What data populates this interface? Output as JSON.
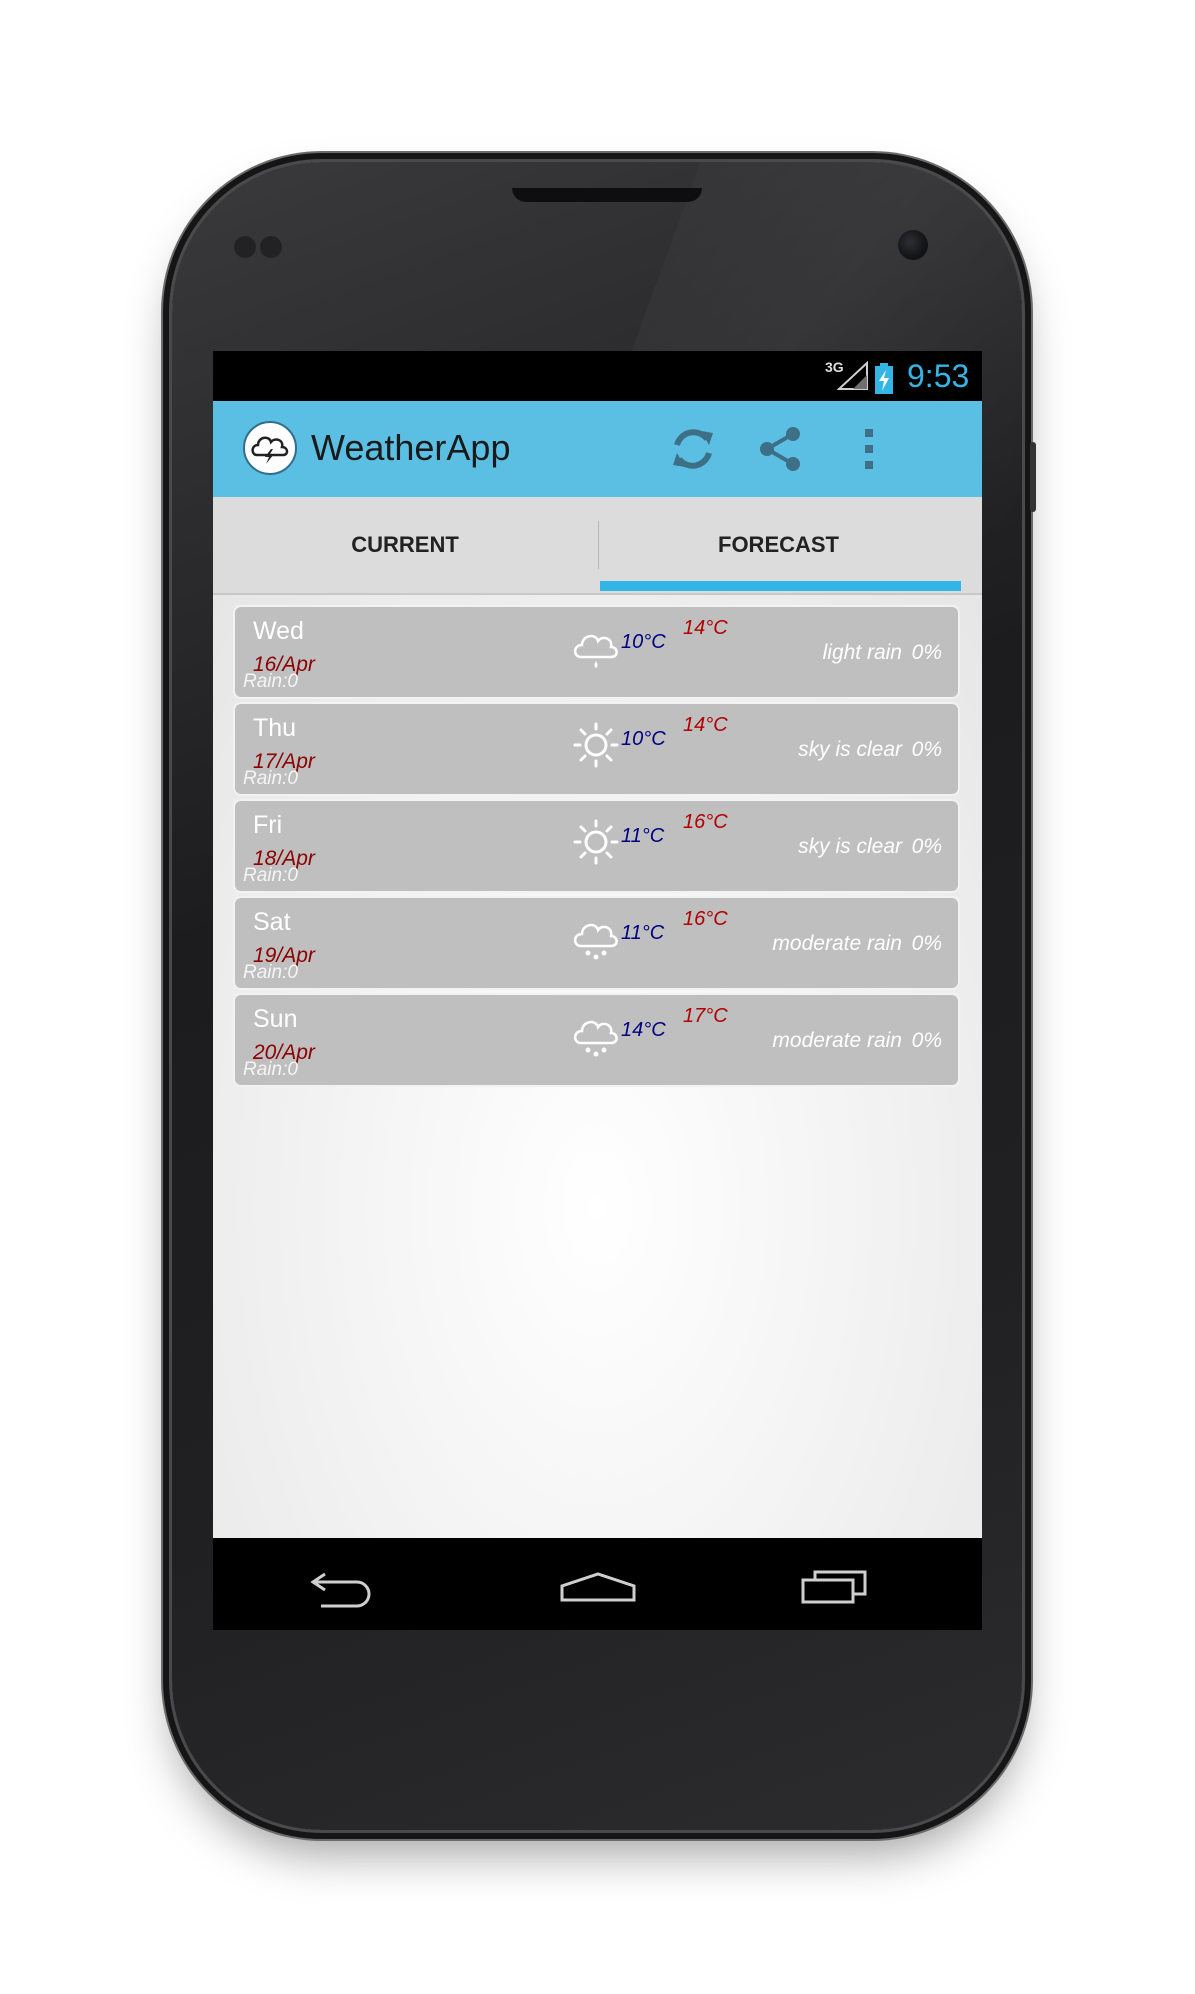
{
  "status_bar": {
    "network": "3G",
    "time": "9:53"
  },
  "action_bar": {
    "title": "WeatherApp",
    "icons": [
      "weather-logo-icon",
      "refresh-icon",
      "share-icon",
      "overflow-menu-icon"
    ]
  },
  "tabs": [
    {
      "label": "CURRENT",
      "selected": false
    },
    {
      "label": "FORECAST",
      "selected": true
    }
  ],
  "forecast": [
    {
      "day": "Wed",
      "date": "16/Apr",
      "rain": "Rain:0",
      "icon": "rain-cloud-icon",
      "min": "10°C",
      "max": "14°C",
      "desc": "light rain",
      "pct": "0%"
    },
    {
      "day": "Thu",
      "date": "17/Apr",
      "rain": "Rain:0",
      "icon": "sun-icon",
      "min": "10°C",
      "max": "14°C",
      "desc": "sky is clear",
      "pct": "0%"
    },
    {
      "day": "Fri",
      "date": "18/Apr",
      "rain": "Rain:0",
      "icon": "sun-icon",
      "min": "11°C",
      "max": "16°C",
      "desc": "sky is clear",
      "pct": "0%"
    },
    {
      "day": "Sat",
      "date": "19/Apr",
      "rain": "Rain:0",
      "icon": "rain-cloud-icon",
      "min": "11°C",
      "max": "16°C",
      "desc": "moderate rain",
      "pct": "0%"
    },
    {
      "day": "Sun",
      "date": "20/Apr",
      "rain": "Rain:0",
      "icon": "rain-cloud-icon",
      "min": "14°C",
      "max": "17°C",
      "desc": "moderate rain",
      "pct": "0%"
    }
  ],
  "nav_bar": {
    "icons": [
      "back-icon",
      "home-icon",
      "recent-apps-icon"
    ]
  },
  "colors": {
    "action_bar": "#5bbfe3",
    "accent": "#33b5e5",
    "card": "#bfbfbf",
    "min_temp": "#000080",
    "max_temp": "#b00000",
    "date": "#8b0000"
  }
}
